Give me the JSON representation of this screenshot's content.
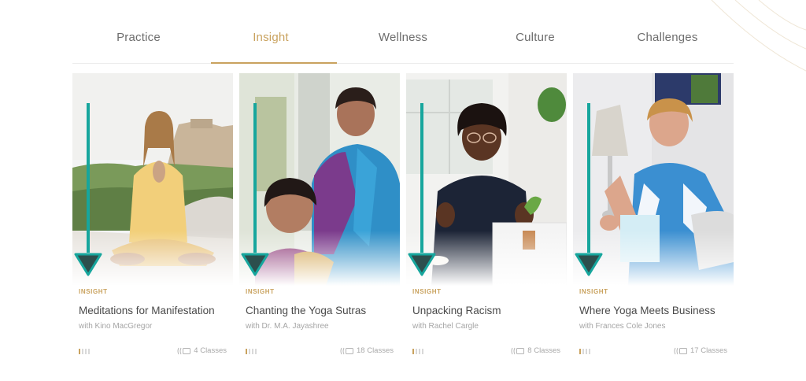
{
  "nav": {
    "tabs": [
      {
        "label": "Practice"
      },
      {
        "label": "Insight"
      },
      {
        "label": "Wellness"
      },
      {
        "label": "Culture"
      },
      {
        "label": "Challenges"
      }
    ],
    "active_tab": "Insight"
  },
  "cards": [
    {
      "tag": "INSIGHT",
      "title": "Meditations for Manifestation",
      "author": "with Kino MacGregor",
      "classes": "4 Classes",
      "level_icon": "level-bars-icon",
      "classes_icon": "classes-icon"
    },
    {
      "tag": "INSIGHT",
      "title": "Chanting the Yoga Sutras",
      "author": "with Dr. M.A. Jayashree",
      "classes": "18 Classes",
      "level_icon": "level-bars-icon",
      "classes_icon": "classes-icon"
    },
    {
      "tag": "INSIGHT",
      "title": "Unpacking Racism",
      "author": "with Rachel Cargle",
      "classes": "8 Classes",
      "level_icon": "level-bars-icon",
      "classes_icon": "classes-icon"
    },
    {
      "tag": "INSIGHT",
      "title": "Where Yoga Meets Business",
      "author": "with Frances Cole Jones",
      "classes": "17 Classes",
      "level_icon": "level-bars-icon",
      "classes_icon": "classes-icon"
    }
  ],
  "colors": {
    "accent": "#c9a25e",
    "arrow": "#17a69d",
    "text": "#4a4a4a",
    "muted": "#a5a5a5"
  }
}
